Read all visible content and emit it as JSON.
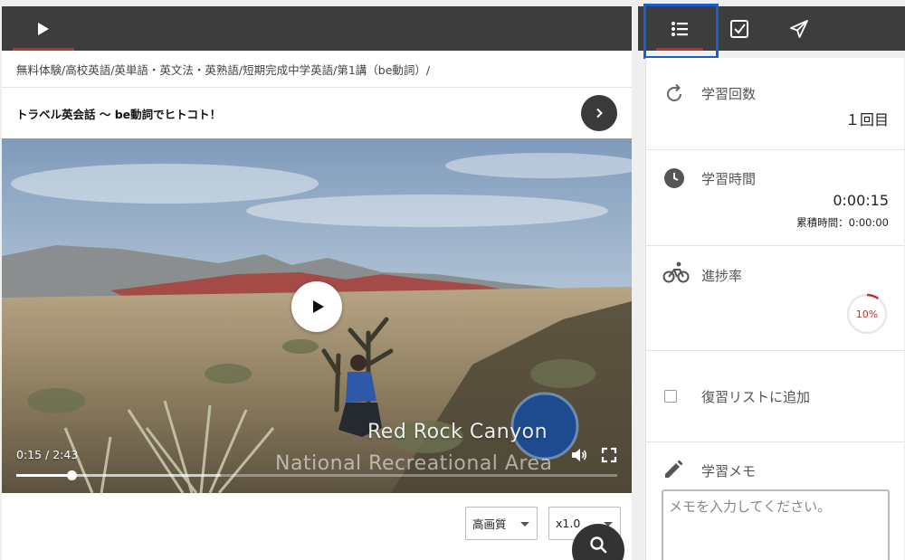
{
  "breadcrumb": "無料体験/高校英語/英単語・英文法・英熟語/短期完成中学英語/第1講（be動詞）/",
  "lesson_title": "トラベル英会話 〜 be動詞でヒトコト！",
  "video": {
    "current_time": "0:15",
    "duration": "2:43",
    "time_display": "0:15 / 2:43",
    "progress_fraction": 0.092,
    "buffered_fraction": 0.34,
    "overlay_title": "Red Rock Canyon",
    "overlay_subtitle": "National Recreational Area"
  },
  "quality_select": {
    "value": "高画質"
  },
  "speed_select": {
    "value": "x1.0"
  },
  "icons": {
    "left_tab": "play-icon",
    "next": "chevron-right-icon",
    "video_play": "play-icon",
    "volume": "volume-icon",
    "fullscreen": "fullscreen-icon",
    "search": "search-icon",
    "right_tabs": [
      "list-icon",
      "checkbox-icon",
      "send-icon"
    ],
    "sections": [
      "refresh-icon",
      "clock-icon",
      "bicycle-icon",
      "checkbox-icon",
      "pencil-icon"
    ]
  },
  "stats": {
    "study_count": {
      "label": "学習回数",
      "value": "１回目"
    },
    "study_time": {
      "label": "学習時間",
      "value": "0:00:15",
      "total": "累積時間：0:00:00"
    },
    "progress": {
      "label": "進捗率",
      "value": "10%",
      "fraction": 0.1
    },
    "review": {
      "label": "復習リストに追加"
    },
    "memo": {
      "label": "学習メモ",
      "placeholder": "メモを入力してください。"
    }
  },
  "colors": {
    "accent_red": "#c0312b",
    "header_dark": "#3d3d3d",
    "focus_blue": "#1a5dd0"
  }
}
